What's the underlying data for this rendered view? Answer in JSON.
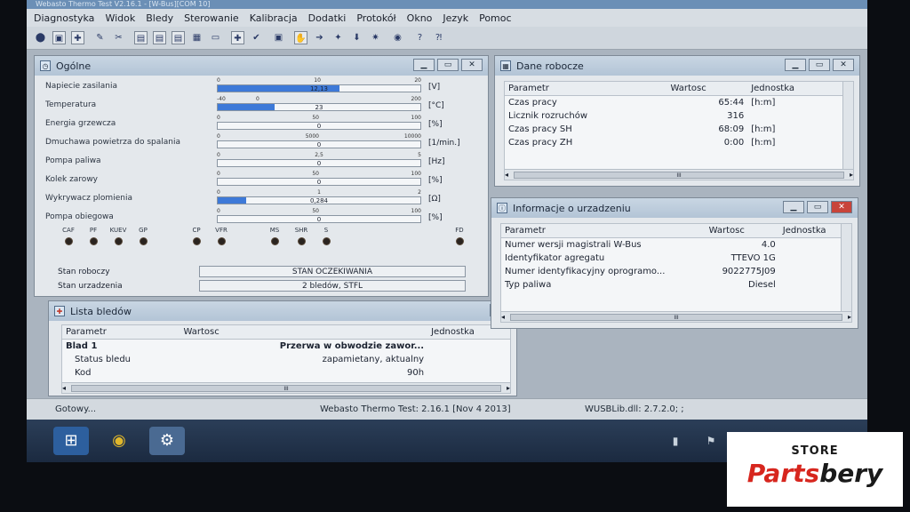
{
  "app": {
    "title": "Webasto Thermo Test V2.16.1 - [W-Bus][COM 10]"
  },
  "menu": [
    "Diagnostyka",
    "Widok",
    "Bledy",
    "Sterowanie",
    "Kalibracja",
    "Dodatki",
    "Protokół",
    "Okno",
    "Jezyk",
    "Pomoc"
  ],
  "ogolne": {
    "title": "Ogólne",
    "gauges": [
      {
        "label": "Napiecie zasilania",
        "scale": [
          "0",
          "10",
          "20"
        ],
        "value": "12,13",
        "fill": 0.6,
        "unit": "[V]"
      },
      {
        "label": "Temperatura",
        "scale": [
          "-40",
          "0",
          "",
          "",
          "",
          "",
          "200"
        ],
        "value": "23",
        "fill": 0.28,
        "unit": "[°C]"
      },
      {
        "label": "Energia grzewcza",
        "scale": [
          "0",
          "50",
          "100"
        ],
        "value": "0",
        "fill": 0,
        "unit": "[%]"
      },
      {
        "label": "Dmuchawa powietrza do spalania",
        "scale": [
          "0",
          "5000",
          "10000"
        ],
        "value": "0",
        "fill": 0,
        "unit": "[1/min.]"
      },
      {
        "label": "Pompa paliwa",
        "scale": [
          "0",
          "2,5",
          "5"
        ],
        "value": "0",
        "fill": 0,
        "unit": "[Hz]"
      },
      {
        "label": "Kolek zarowy",
        "scale": [
          "0",
          "50",
          "100"
        ],
        "value": "0",
        "fill": 0,
        "unit": "[%]"
      },
      {
        "label": "Wykrywacz plomienia",
        "scale": [
          "0",
          "1",
          "2"
        ],
        "value": "0,284",
        "fill": 0.14,
        "unit": "[Ω]"
      },
      {
        "label": "Pompa obiegowa",
        "scale": [
          "0",
          "50",
          "100"
        ],
        "value": "0",
        "fill": 0,
        "unit": "[%]"
      }
    ],
    "leds": [
      {
        "label": "CAF"
      },
      {
        "label": "PF"
      },
      {
        "label": "KUEV"
      },
      {
        "label": "GP"
      },
      {
        "label": "CP"
      },
      {
        "label": "VFR"
      },
      {
        "label": "MS"
      },
      {
        "label": "SHR"
      },
      {
        "label": "S"
      },
      {
        "label": "FD"
      }
    ],
    "stan_roboczy_label": "Stan roboczy",
    "stan_roboczy_value": "STAN OCZEKIWANIA",
    "stan_urzadzenia_label": "Stan urzadzenia",
    "stan_urzadzenia_value": "2 bledów, STFL"
  },
  "lista": {
    "title": "Lista bledów",
    "headers": [
      "Parametr",
      "Wartosc",
      "Jednostka"
    ],
    "rows": [
      {
        "param": "Blad 1",
        "value": "Przerwa w obwodzie zawor..."
      },
      {
        "param": "Status bledu",
        "value": "zapamietany, aktualny"
      },
      {
        "param": "Kod",
        "value": "90h"
      }
    ],
    "scroll_thumb": "III"
  },
  "dane": {
    "title": "Dane robocze",
    "headers": [
      "Parametr",
      "Wartosc",
      "Jednostka"
    ],
    "rows": [
      {
        "param": "Czas pracy",
        "value": "65:44",
        "unit": "[h:m]"
      },
      {
        "param": "Licznik rozruchów",
        "value": "316",
        "unit": ""
      },
      {
        "param": "Czas pracy SH",
        "value": "68:09",
        "unit": "[h:m]"
      },
      {
        "param": "Czas pracy ZH",
        "value": "0:00",
        "unit": "[h:m]"
      }
    ],
    "scroll_thumb": "III"
  },
  "info": {
    "title": "Informacje o urzadzeniu",
    "headers": [
      "Parametr",
      "Wartosc",
      "Jednostka"
    ],
    "rows": [
      {
        "param": "Numer wersji magistrali W-Bus",
        "value": "4.0"
      },
      {
        "param": "Identyfikator agregatu",
        "value": "TTEVO 1G"
      },
      {
        "param": "Numer identyfikacyjny oprogramo...",
        "value": "9022775J09"
      },
      {
        "param": "Typ paliwa",
        "value": "Diesel"
      }
    ],
    "scroll_thumb": "III"
  },
  "status": {
    "left": "Gotowy...",
    "center": "Webasto Thermo Test: 2.16.1 [Nov  4 2013]",
    "right": "WUSBLib.dll: 2.7.2.0; ;"
  },
  "logo": {
    "store": "STORE",
    "brand_a": "Parts",
    "brand_b": "bery"
  },
  "colors": {
    "accent": "#3d79d8",
    "brand_red": "#d7261e"
  }
}
